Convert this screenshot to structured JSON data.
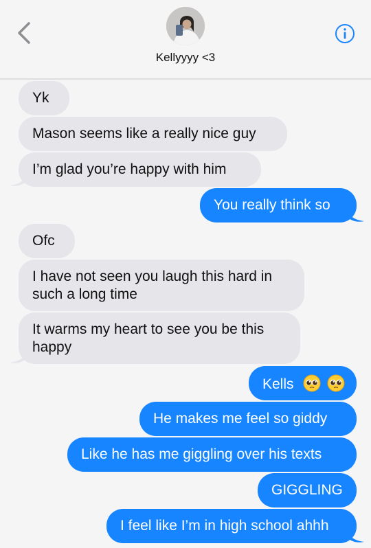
{
  "header": {
    "contact_name": "Kellyyyy <3",
    "back_icon": "chevron-left-icon",
    "info_icon": "info-circle-icon",
    "accent_color": "#1685ff"
  },
  "messages": [
    {
      "direction": "incoming",
      "text": "Yk"
    },
    {
      "direction": "incoming",
      "text": "Mason seems like a really nice guy"
    },
    {
      "direction": "incoming",
      "text": "I’m glad you’re happy with him"
    },
    {
      "direction": "outgoing",
      "text": "You really think so"
    },
    {
      "direction": "incoming",
      "text": "Ofc"
    },
    {
      "direction": "incoming",
      "text": "I have not seen you laugh this hard in such a long time"
    },
    {
      "direction": "incoming",
      "text": "It warms my heart to see you be this happy"
    },
    {
      "direction": "outgoing",
      "text": "Kells",
      "emojis": [
        "pleading-face-emoji",
        "pleading-face-emoji"
      ]
    },
    {
      "direction": "outgoing",
      "text": "He makes me feel so giddy"
    },
    {
      "direction": "outgoing",
      "text": "Like he has me giggling over his texts"
    },
    {
      "direction": "outgoing",
      "text": "GIGGLING"
    },
    {
      "direction": "outgoing",
      "text": "I feel like I’m in high school ahhh"
    }
  ]
}
